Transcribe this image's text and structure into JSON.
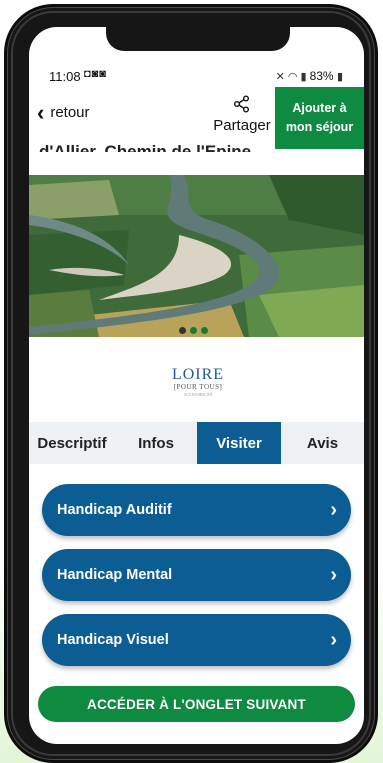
{
  "status_bar": {
    "time": "11:08",
    "notification_icons": "◘◙◙",
    "battery": "83%"
  },
  "header": {
    "back_label": "retour",
    "share_label": "Partager",
    "add_label": "Ajouter à mon séjour"
  },
  "page": {
    "title_partial": "d'Allier, Chemin de l'Epine"
  },
  "hero": {
    "carousel_count": 3,
    "active_slide": 1
  },
  "partner_logo": {
    "main": "LOIRE",
    "sub": "[POUR TOUS]",
    "tag": "ACCESSIBILITÉ"
  },
  "tabs": [
    {
      "label": "Descriptif",
      "active": false
    },
    {
      "label": "Infos",
      "active": false
    },
    {
      "label": "Visiter",
      "active": true
    },
    {
      "label": "Avis",
      "active": false
    }
  ],
  "sections": [
    {
      "label": "Handicap Auditif"
    },
    {
      "label": "Handicap Mental"
    },
    {
      "label": "Handicap Visuel"
    }
  ],
  "next_button": {
    "label": "ACCÉDER À L'ONGLET SUIVANT"
  },
  "colors": {
    "primary_blue": "#0b5d94",
    "primary_green": "#0e8a41",
    "tab_bar_bg": "#eef1f4"
  }
}
